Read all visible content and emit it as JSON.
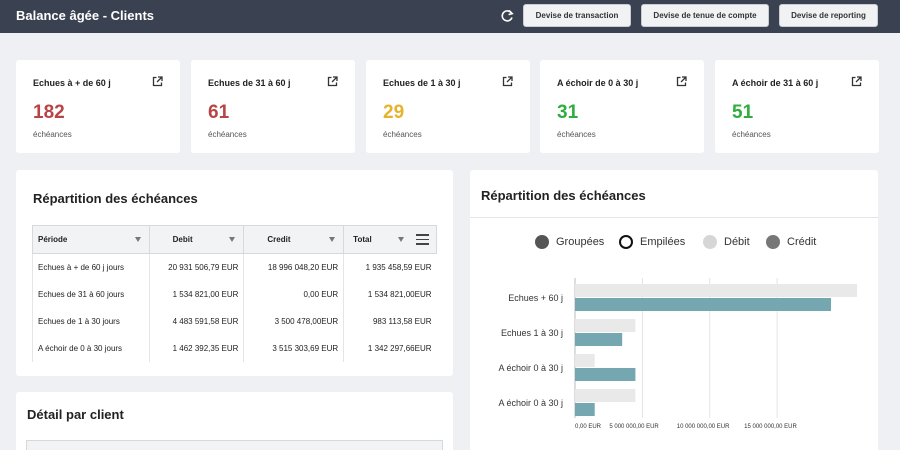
{
  "header": {
    "title": "Balance âgée - Clients",
    "buttons": [
      "Devise de transaction",
      "Devise de tenue de compte",
      "Devise de reporting"
    ]
  },
  "kpis": [
    {
      "label": "Echues à + de 60 j",
      "value": "182",
      "sub": "échéances",
      "color": "#b84445"
    },
    {
      "label": "Echues de 31 à  60 j",
      "value": "61",
      "sub": "échéances",
      "color": "#b84445"
    },
    {
      "label": "Echues de 1 à 30 j",
      "value": "29",
      "sub": "échéances",
      "color": "#e6b32c"
    },
    {
      "label": "A échoir de 0 à 30 j",
      "value": "31",
      "sub": "échéances",
      "color": "#2fae3f"
    },
    {
      "label": "A échoir de 31 à 60 j",
      "value": "51",
      "sub": "échéances",
      "color": "#2fae3f"
    }
  ],
  "table_card": {
    "title": "Répartition des échéances",
    "columns": [
      "Période",
      "Debit",
      "Credit",
      "Total"
    ],
    "rows": [
      [
        "Echues à + de 60 j jours",
        "20 931 506,79 EUR",
        "18 996 048,20 EUR",
        "1 935 458,59 EUR"
      ],
      [
        "Echues de 31 à  60 jours",
        "1 534 821,00 EUR",
        "0,00 EUR",
        "1 534 821,00EUR"
      ],
      [
        "Echues de 1 à 30 jours",
        "4 483 591,58 EUR",
        "3 500 478,00EUR",
        "983 113,58 EUR"
      ],
      [
        "A échoir de 0 à 30 jours",
        "1 462 392,35 EUR",
        "3 515 303,69 EUR",
        "1 342 297,66EUR"
      ]
    ]
  },
  "chart_card": {
    "title": "Répartition des échéances",
    "legend": [
      {
        "label": "Groupées",
        "style": "filled",
        "color": "#555555"
      },
      {
        "label": "Empilées",
        "style": "ring",
        "color": "#111111"
      },
      {
        "label": "Débit",
        "style": "filled",
        "color": "#d6d6d6"
      },
      {
        "label": "Crédit",
        "style": "filled",
        "color": "#777777"
      }
    ]
  },
  "detail_card": {
    "title": "Détail par client"
  },
  "chart_data": {
    "type": "bar",
    "orientation": "horizontal",
    "categories": [
      "Echues + 60 j",
      "Echues 1 à  30 j",
      "A échoir 0 à 30 j",
      "A échoir 0 à 30 j"
    ],
    "series": [
      {
        "name": "Débit",
        "color": "#e8e9e8",
        "values": [
          20931506.79,
          4483591.58,
          1462392.35,
          4483591.58
        ]
      },
      {
        "name": "Crédit",
        "color": "#74a7b0",
        "values": [
          18996048.2,
          3500478.0,
          4483591.58,
          1462392.35
        ]
      }
    ],
    "xticks": [
      "0,00 EUR",
      "5 000 000,00 EUR",
      "10 000 000,00 EUR",
      "15 000 000,00 EUR"
    ],
    "xtick_values": [
      0,
      5000000,
      10000000,
      15000000
    ],
    "xlim": [
      0,
      21000000
    ],
    "grid": true
  }
}
